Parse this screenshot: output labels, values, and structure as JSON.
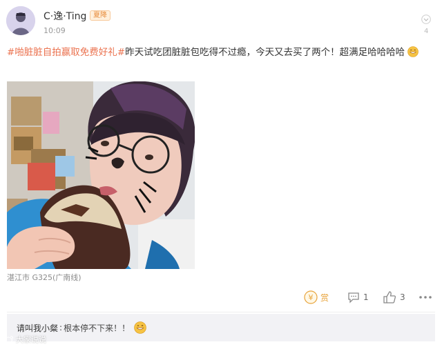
{
  "post": {
    "username": "C·逸·Ting",
    "badge": "夏降",
    "time": "10:09",
    "corner_count": "4",
    "hashtags": [
      "#啪脏脏自拍赢取免费好礼#"
    ],
    "text": "昨天试吃团脏脏包吃得不过瘾，今天又去买了两个！超满足哈哈哈哈",
    "emoji_icon": "grin-emoji-icon",
    "location": "湛江市 G325(广南线)"
  },
  "actions": {
    "reward_label": "赏",
    "comment_count": "1",
    "like_count": "3"
  },
  "comment": {
    "user": "请叫我小粲",
    "separator": ":",
    "text": " 根本停不下来！！"
  },
  "watermark": {
    "text": "大家说说"
  },
  "colors": {
    "hashtag": "#eb7350",
    "reward": "#e8a33a",
    "text": "#333333",
    "muted": "#999999"
  }
}
